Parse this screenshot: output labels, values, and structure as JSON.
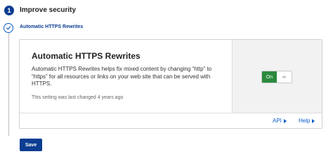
{
  "step": {
    "number": "1",
    "title": "Improve security"
  },
  "setting": {
    "name": "Automatic HTTPS Rewrites"
  },
  "card": {
    "title": "Automatic HTTPS Rewrites",
    "description": "Automatic HTTPS Rewrites helps fix mixed content by changing “http” to “https” for all resources or links on your web site that can be served with HTTPS.",
    "last_changed": "This setting was last changed 4 years ago",
    "toggle": {
      "state_label": "On",
      "knob_glyph": "‹›"
    },
    "footer": {
      "api_label": "API",
      "help_label": "Help"
    }
  },
  "actions": {
    "save_label": "Save"
  },
  "colors": {
    "primary": "#0b3d91",
    "link": "#0b5cc8",
    "toggle_on": "#2b8a3e"
  }
}
